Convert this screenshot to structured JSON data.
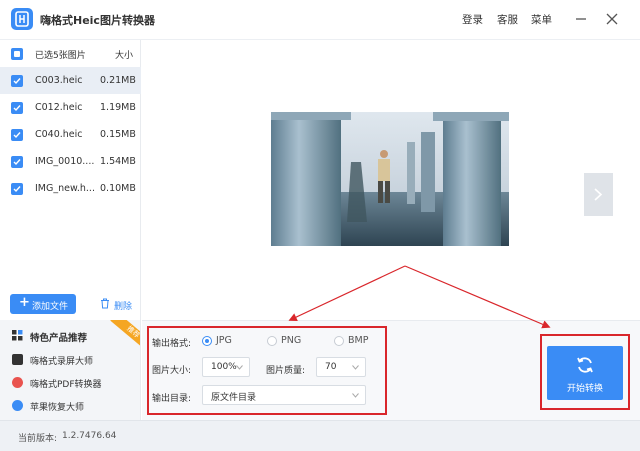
{
  "app": {
    "title": "嗨格式Heic图片转换器",
    "logo_icon": "image-convert-icon",
    "accent_color": "#3a8cf5"
  },
  "topbar": {
    "login": "登录",
    "support": "客服",
    "menu": "菜单",
    "minimize_icon": "minimize-icon",
    "close_icon": "close-icon"
  },
  "file_list": {
    "header_label": "已选5张图片",
    "header_size": "大小",
    "files": [
      {
        "name": "C003.heic",
        "size": "0.21MB",
        "selected": true
      },
      {
        "name": "C012.heic",
        "size": "1.19MB",
        "selected": false
      },
      {
        "name": "C040.heic",
        "size": "0.15MB",
        "selected": false
      },
      {
        "name": "IMG_0010....",
        "size": "1.54MB",
        "selected": false
      },
      {
        "name": "IMG_new.h...",
        "size": "0.10MB",
        "selected": false
      }
    ],
    "add_button": "添加文件",
    "delete_button": "删除"
  },
  "products": {
    "title": "特色产品推荐",
    "ribbon": "推荐",
    "items": [
      {
        "label": "嗨格式录屏大师",
        "icon": "screen-record-icon",
        "color": "#333333"
      },
      {
        "label": "嗨格式PDF转换器",
        "icon": "pdf-icon",
        "color": "#e9534f"
      },
      {
        "label": "苹果恢复大师",
        "icon": "recovery-icon",
        "color": "#3a8cf5"
      }
    ]
  },
  "preview": {
    "image_desc": "photo-preview",
    "next_icon": "chevron-right-icon"
  },
  "settings": {
    "format_label": "输出格式:",
    "formats": [
      {
        "label": "JPG",
        "checked": true
      },
      {
        "label": "PNG",
        "checked": false
      },
      {
        "label": "BMP",
        "checked": false
      }
    ],
    "size_label": "图片大小:",
    "size_value": "100%",
    "quality_label": "图片质量:",
    "quality_value": "70",
    "dir_label": "输出目录:",
    "dir_value": "原文件目录",
    "start_button": "开始转换",
    "start_icon": "refresh-icon"
  },
  "status": {
    "version_label": "当前版本:",
    "version_value": "1.2.7476.64"
  }
}
